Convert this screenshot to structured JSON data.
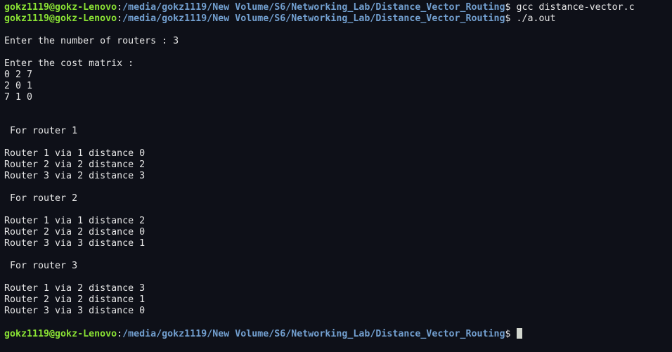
{
  "colors": {
    "background": "#0e1018",
    "foreground": "#e6e6e6",
    "user_host": "#8ae234",
    "path": "#729fcf",
    "cursor": "#d3d7cf"
  },
  "prompt": {
    "user_host": "gokz1119@gokz-Lenovo",
    "separator": ":",
    "path": "/media/gokz1119/New Volume/S6/Networking_Lab/Distance_Vector_Routing",
    "sign": "$"
  },
  "commands": [
    " gcc distance-vector.c",
    " ./a.out",
    " "
  ],
  "output": {
    "routers_prompt": "Enter the number of routers : 3",
    "matrix_prompt": "Enter the cost matrix :",
    "matrix_rows": [
      "0 2 7",
      "2 0 1",
      "7 1 0"
    ],
    "router_blocks": [
      {
        "heading": " For router 1",
        "lines": [
          "Router 1 via 1 distance 0",
          "Router 2 via 2 distance 2",
          "Router 3 via 2 distance 3"
        ]
      },
      {
        "heading": " For router 2",
        "lines": [
          "Router 1 via 1 distance 2",
          "Router 2 via 2 distance 0",
          "Router 3 via 3 distance 1"
        ]
      },
      {
        "heading": " For router 3",
        "lines": [
          "Router 1 via 2 distance 3",
          "Router 2 via 2 distance 1",
          "Router 3 via 3 distance 0"
        ]
      }
    ]
  }
}
